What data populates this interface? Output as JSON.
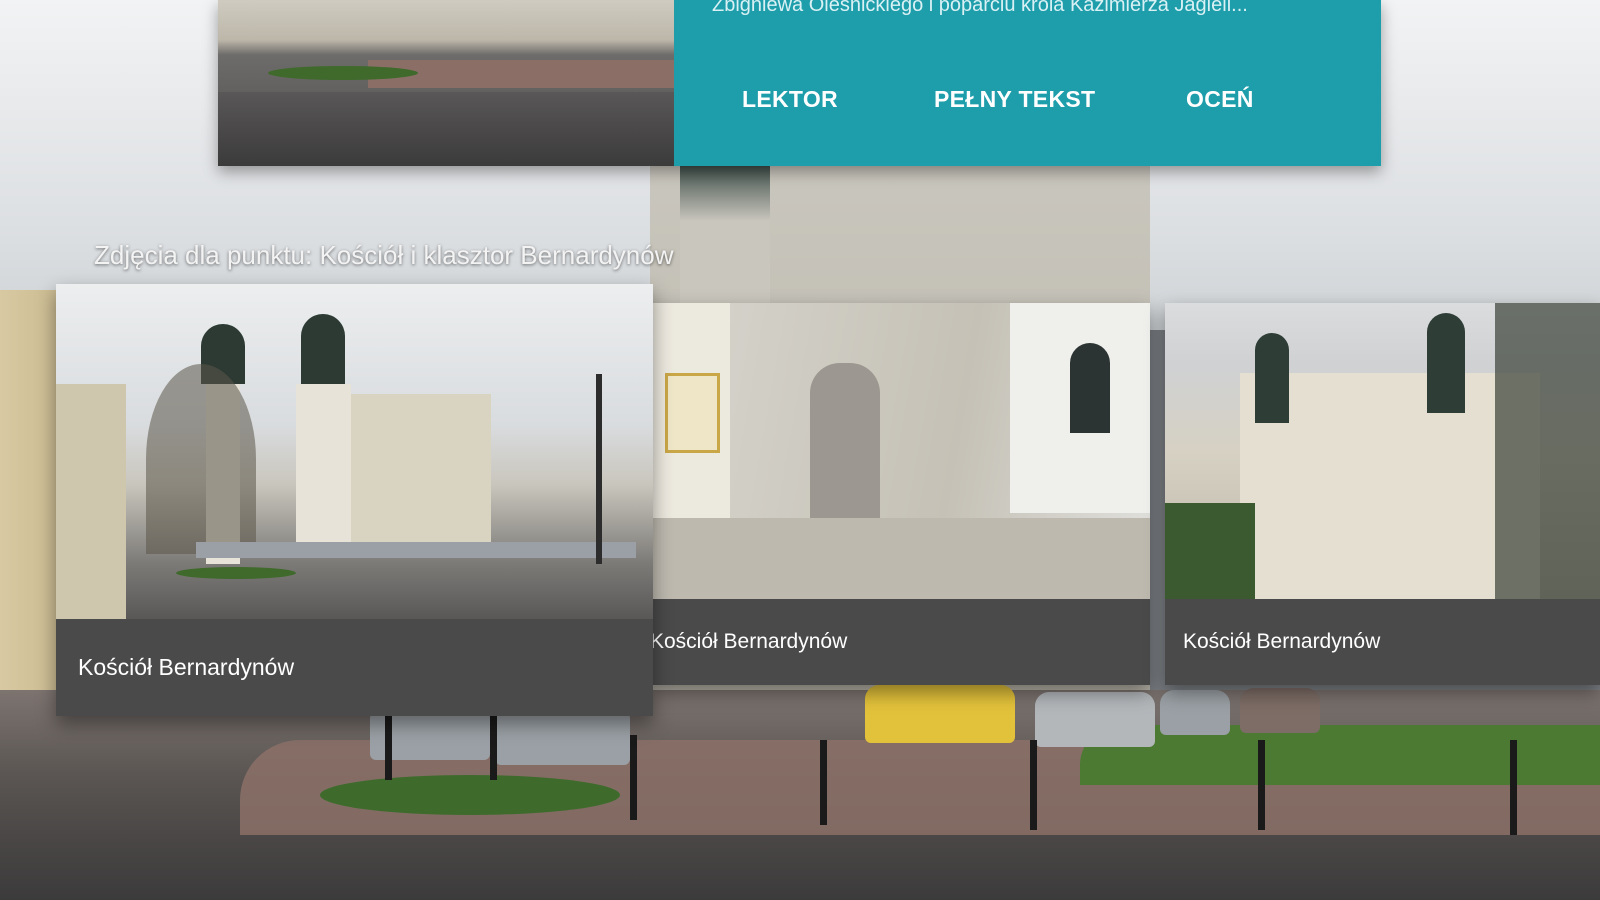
{
  "info_card": {
    "excerpt": "Zbigniewa Oleśnickiego i poparciu króla Kazimierza Jagiell...",
    "actions": [
      "LEKTOR",
      "PEŁNY TEKST",
      "OCEŃ"
    ]
  },
  "gallery": {
    "title": "Zdjęcia dla punktu: Kościół i klasztor Bernardynów",
    "photos": [
      {
        "caption": "Kościół Bernardynów"
      },
      {
        "caption": "Kościół Bernardynów"
      },
      {
        "caption": "Kościół Bernardynów"
      }
    ]
  },
  "colors": {
    "accent_panel": "#1e9dab",
    "caption_bg": "#4a4a4a"
  }
}
